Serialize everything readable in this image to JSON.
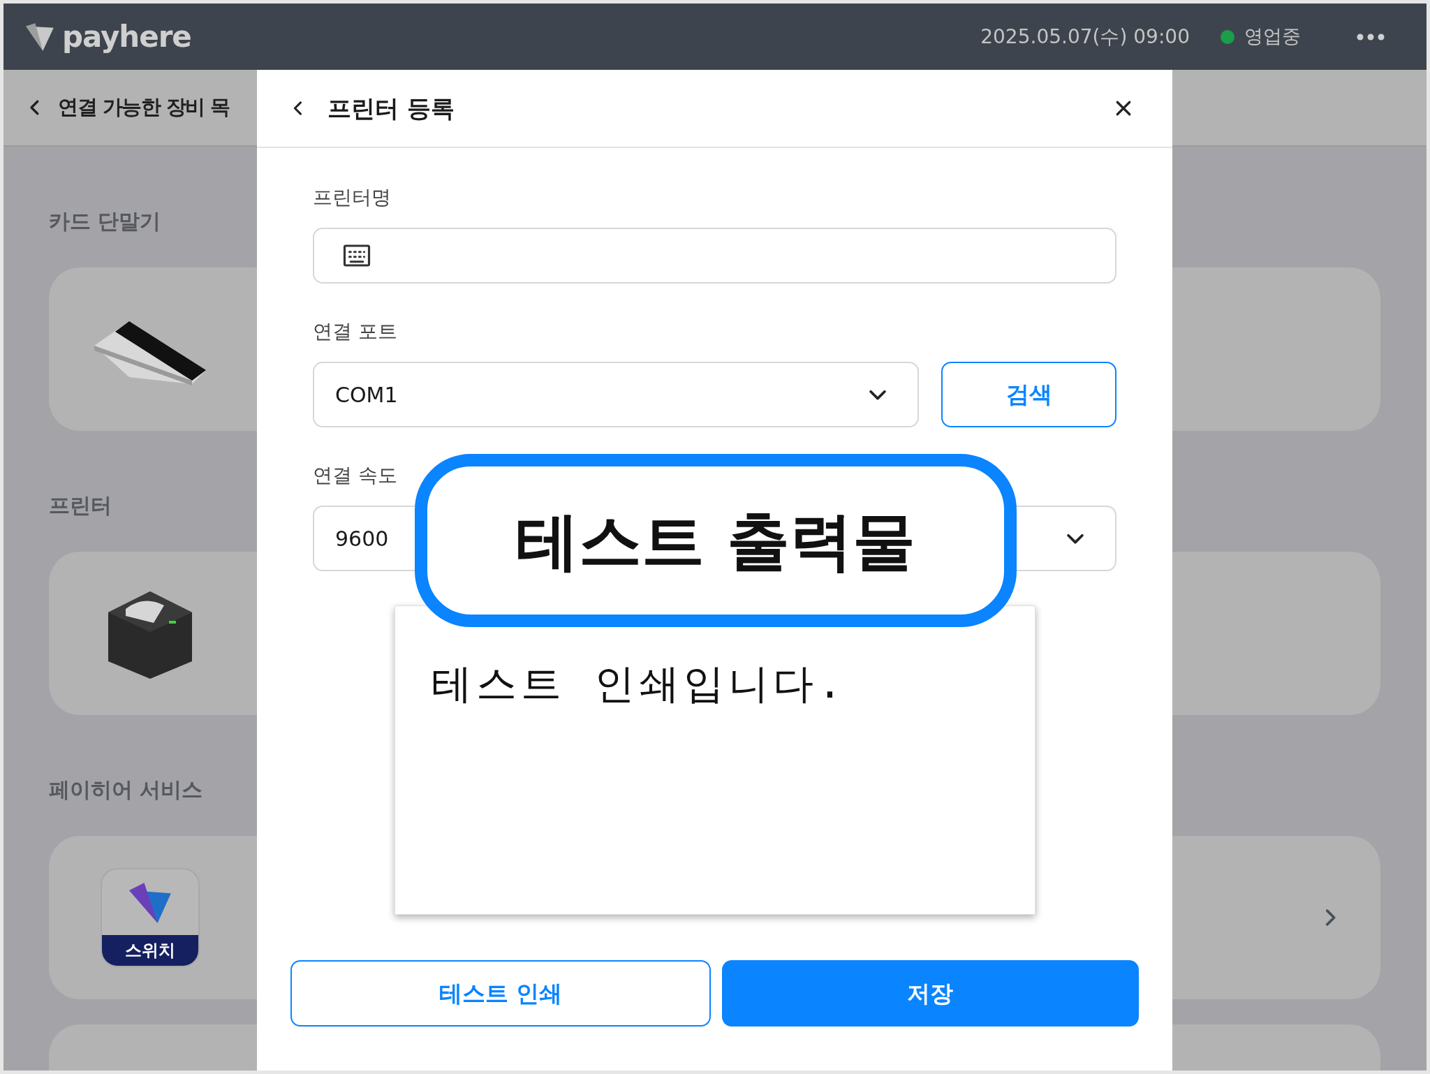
{
  "header": {
    "logo": "payhere",
    "datetime": "2025.05.07(수) 09:00",
    "status": {
      "label": "영업중",
      "color": "#1a9e4b"
    }
  },
  "background": {
    "title": "연결 가능한 장비 목",
    "sections": [
      {
        "title": "카드 단말기",
        "kind": "terminal"
      },
      {
        "title": "프린터",
        "kind": "printer"
      },
      {
        "title": "페이히어 서비스",
        "kind": "app",
        "app_label": "스위치"
      }
    ]
  },
  "dialog": {
    "title": "프린터 등록",
    "fields": [
      {
        "label": "프린터명",
        "kind": "text"
      },
      {
        "label": "연결 포트",
        "kind": "select",
        "value": "COM1",
        "button": "검색"
      },
      {
        "label": "연결 속도",
        "kind": "select",
        "value": "9600"
      }
    ],
    "preview": {
      "title": "테스트 출력물",
      "text": "테스트 인쇄입니다."
    },
    "buttons": [
      {
        "label": "테스트 인쇄",
        "kind": "secondary"
      },
      {
        "label": "저장",
        "kind": "primary"
      }
    ]
  }
}
